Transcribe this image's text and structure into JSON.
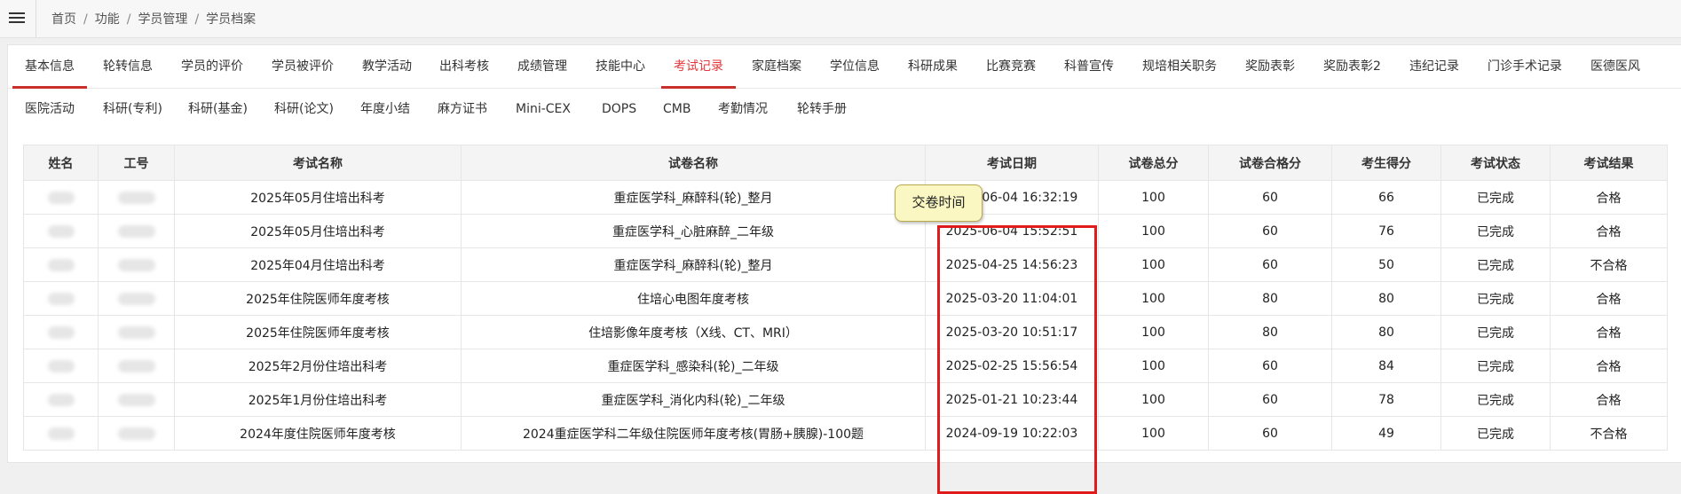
{
  "breadcrumb": [
    "首页",
    "功能",
    "学员管理",
    "学员档案"
  ],
  "tabs_row1": [
    "基本信息",
    "轮转信息",
    "学员的评价",
    "学员被评价",
    "教学活动",
    "出科考核",
    "成绩管理",
    "技能中心",
    "考试记录",
    "家庭档案",
    "学位信息",
    "科研成果",
    "比赛竞赛",
    "科普宣传",
    "规培相关职务",
    "奖励表彰",
    "奖励表彰2",
    "违纪记录",
    "门诊手术记录",
    "医德医风"
  ],
  "tabs_row2": [
    "医院活动",
    "科研(专利)",
    "科研(基金)",
    "科研(论文)",
    "年度小结",
    "麻方证书",
    "Mini-CEX",
    "DOPS",
    "CMB",
    "考勤情况",
    "轮转手册"
  ],
  "active_tab": "考试记录",
  "tooltip": "交卷时间",
  "table": {
    "headers": [
      "姓名",
      "工号",
      "考试名称",
      "试卷名称",
      "考试日期",
      "试卷总分",
      "试卷合格分",
      "考生得分",
      "考试状态",
      "考试结果"
    ],
    "rows": [
      [
        "",
        "",
        "2025年05月住培出科考",
        "重症医学科_麻醉科(轮)_整月",
        "2025-06-04 16:32:19",
        "100",
        "60",
        "66",
        "已完成",
        "合格"
      ],
      [
        "",
        "",
        "2025年05月住培出科考",
        "重症医学科_心脏麻醉_二年级",
        "2025-06-04 15:52:51",
        "100",
        "60",
        "76",
        "已完成",
        "合格"
      ],
      [
        "",
        "",
        "2025年04月住培出科考",
        "重症医学科_麻醉科(轮)_整月",
        "2025-04-25 14:56:23",
        "100",
        "60",
        "50",
        "已完成",
        "不合格"
      ],
      [
        "",
        "",
        "2025年住院医师年度考核",
        "住培心电图年度考核",
        "2025-03-20 11:04:01",
        "100",
        "80",
        "80",
        "已完成",
        "合格"
      ],
      [
        "",
        "",
        "2025年住院医师年度考核",
        "住培影像年度考核（X线、CT、MRI）",
        "2025-03-20 10:51:17",
        "100",
        "80",
        "80",
        "已完成",
        "合格"
      ],
      [
        "",
        "",
        "2025年2月份住培出科考",
        "重症医学科_感染科(轮)_二年级",
        "2025-02-25 15:56:54",
        "100",
        "60",
        "84",
        "已完成",
        "合格"
      ],
      [
        "",
        "",
        "2025年1月份住培出科考",
        "重症医学科_消化内科(轮)_二年级",
        "2025-01-21 10:23:44",
        "100",
        "60",
        "78",
        "已完成",
        "合格"
      ],
      [
        "",
        "",
        "2024年度住院医师年度考核",
        "2024重症医学科二年级住院医师年度考核(胃肠+胰腺)-100题",
        "2024-09-19 10:22:03",
        "100",
        "60",
        "49",
        "已完成",
        "不合格"
      ]
    ]
  },
  "colors": {
    "active_tab": "#e4393c",
    "highlight": "#e01b1b",
    "tooltip_bg": "#fbf7c3"
  }
}
